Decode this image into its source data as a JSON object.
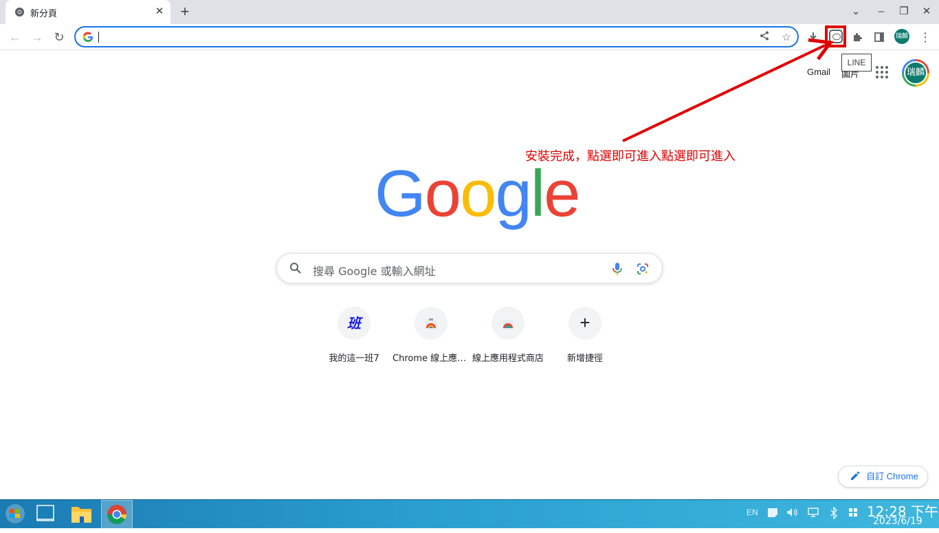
{
  "browser": {
    "tab": {
      "title": "新分頁",
      "close": "✕"
    },
    "new_tab": "+",
    "window_controls": {
      "tab_search": "⌄",
      "minimize": "–",
      "restore": "❐",
      "close": "✕"
    },
    "nav": {
      "back": "←",
      "forward": "→",
      "reload": "↻"
    },
    "omnibox": {
      "value": "",
      "placeholder": ""
    },
    "extensions": {
      "tooltip": "LINE"
    },
    "profile_initials": "瑞麟",
    "menu": "⋮"
  },
  "header": {
    "gmail": "Gmail",
    "images": "圖片",
    "avatar_text": "瑞麟"
  },
  "annotation": {
    "text": "安裝完成，點選即可進入點選即可進入",
    "color": "#e00000"
  },
  "logo": {
    "letters": [
      {
        "char": "G",
        "color": "#4285f4"
      },
      {
        "char": "o",
        "color": "#ea4335"
      },
      {
        "char": "o",
        "color": "#fbbc05"
      },
      {
        "char": "g",
        "color": "#4285f4"
      },
      {
        "char": "l",
        "color": "#34a853"
      },
      {
        "char": "e",
        "color": "#ea4335"
      }
    ]
  },
  "search": {
    "placeholder": "搜尋 Google 或輸入網址"
  },
  "shortcuts": [
    {
      "label": "我的這一班7",
      "icon": "班"
    },
    {
      "label": "Chrome 線上應用程式商店",
      "icon": "chrome-webstore-icon"
    },
    {
      "label": "線上應用程式商店",
      "icon": "chrome-webstore-icon"
    },
    {
      "label": "新增捷徑",
      "icon": "+"
    }
  ],
  "customize": {
    "label": "自訂 Chrome"
  },
  "taskbar": {
    "lang": "EN",
    "time": "12:28 下午",
    "date": "2023/6/19"
  }
}
